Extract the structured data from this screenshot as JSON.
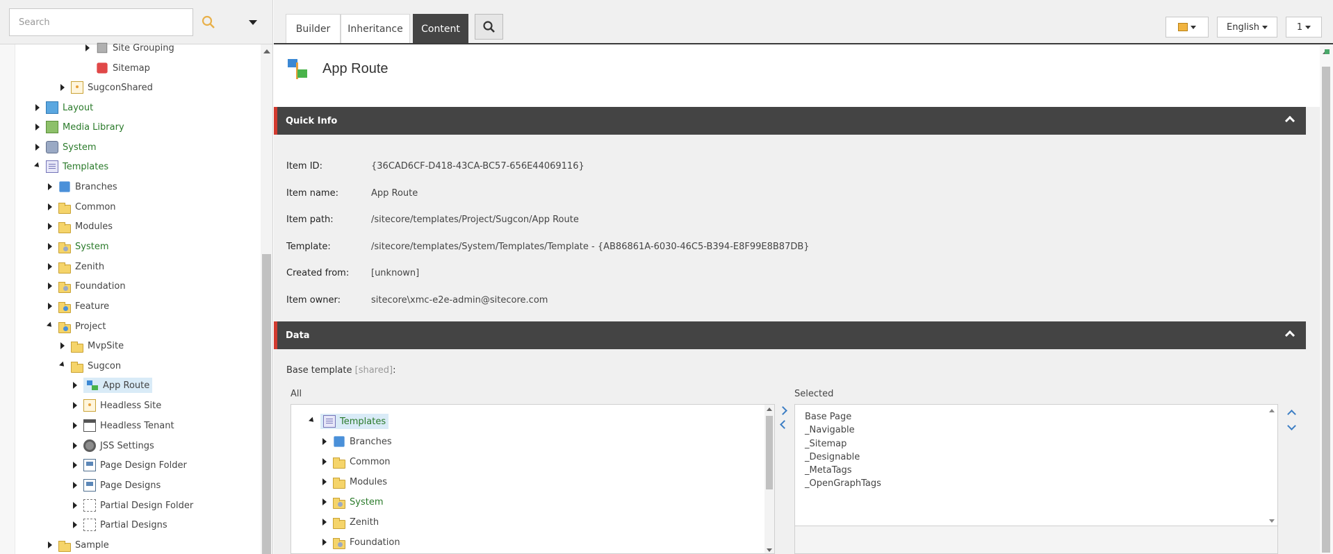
{
  "search": {
    "placeholder": "Search",
    "value": ""
  },
  "tree": {
    "nodes": [
      {
        "label": "Site Grouping",
        "icon": "site-grouping-icon",
        "green": false
      },
      {
        "label": "Sitemap",
        "icon": "sitemap-icon",
        "green": false
      },
      {
        "label": "SugconShared",
        "icon": "site-icon",
        "green": false
      },
      {
        "label": "Layout",
        "icon": "layout-icon",
        "green": true
      },
      {
        "label": "Media Library",
        "icon": "media-library-icon",
        "green": true
      },
      {
        "label": "System",
        "icon": "system-icon",
        "green": true
      },
      {
        "label": "Templates",
        "icon": "templates-icon",
        "green": true
      },
      {
        "label": "Branches",
        "icon": "branches-icon",
        "green": false
      },
      {
        "label": "Common",
        "icon": "folder-icon",
        "green": false
      },
      {
        "label": "Modules",
        "icon": "folder-icon",
        "green": false
      },
      {
        "label": "System",
        "icon": "system-folder-icon",
        "green": true
      },
      {
        "label": "Zenith",
        "icon": "folder-icon",
        "green": false
      },
      {
        "label": "Foundation",
        "icon": "foundation-folder-icon",
        "green": false
      },
      {
        "label": "Feature",
        "icon": "feature-folder-icon",
        "green": false
      },
      {
        "label": "Project",
        "icon": "project-folder-icon",
        "green": false
      },
      {
        "label": "MvpSite",
        "icon": "folder-icon",
        "green": false
      },
      {
        "label": "Sugcon",
        "icon": "folder-icon",
        "green": false
      },
      {
        "label": "App Route",
        "icon": "app-route-icon",
        "green": false
      },
      {
        "label": "Headless Site",
        "icon": "headless-site-icon",
        "green": false
      },
      {
        "label": "Headless Tenant",
        "icon": "headless-tenant-icon",
        "green": false
      },
      {
        "label": "JSS Settings",
        "icon": "gear-icon",
        "green": false
      },
      {
        "label": "Page Design Folder",
        "icon": "page-design-folder-icon",
        "green": false
      },
      {
        "label": "Page Designs",
        "icon": "page-designs-icon",
        "green": false
      },
      {
        "label": "Partial Design Folder",
        "icon": "partial-design-folder-icon",
        "green": false
      },
      {
        "label": "Partial Designs",
        "icon": "partial-designs-icon",
        "green": false
      },
      {
        "label": "Sample",
        "icon": "folder-icon",
        "green": false
      }
    ]
  },
  "tabs": [
    {
      "label": "Builder"
    },
    {
      "label": "Inheritance"
    },
    {
      "label": "Content"
    }
  ],
  "topbar": {
    "language": "English",
    "version": "1"
  },
  "item": {
    "title": "App Route"
  },
  "quick_info": {
    "title": "Quick Info",
    "rows": [
      {
        "key": "Item ID:",
        "value": "{36CAD6CF-D418-43CA-BC57-656E44069116}"
      },
      {
        "key": "Item name:",
        "value": "App Route"
      },
      {
        "key": "Item path:",
        "value": "/sitecore/templates/Project/Sugcon/App Route"
      },
      {
        "key": "Template:",
        "value": "/sitecore/templates/System/Templates/Template - {AB86861A-6030-46C5-B394-E8F99E8B87DB}"
      },
      {
        "key": "Created from:",
        "value": "[unknown]"
      },
      {
        "key": "Item owner:",
        "value": "sitecore\\xmc-e2e-admin@sitecore.com"
      }
    ]
  },
  "data_section": {
    "title": "Data",
    "base_template_label": "Base template",
    "shared_tag": "[shared]",
    "all_label": "All",
    "selected_label": "Selected",
    "all_tree": [
      {
        "label": "Templates",
        "green": true
      },
      {
        "label": "Branches",
        "green": false
      },
      {
        "label": "Common",
        "green": false
      },
      {
        "label": "Modules",
        "green": false
      },
      {
        "label": "System",
        "green": true
      },
      {
        "label": "Zenith",
        "green": false
      },
      {
        "label": "Foundation",
        "green": false
      }
    ],
    "selected": [
      "Base Page",
      "_Navigable",
      "_Sitemap",
      "_Designable",
      "_MetaTags",
      "_OpenGraphTags"
    ]
  }
}
